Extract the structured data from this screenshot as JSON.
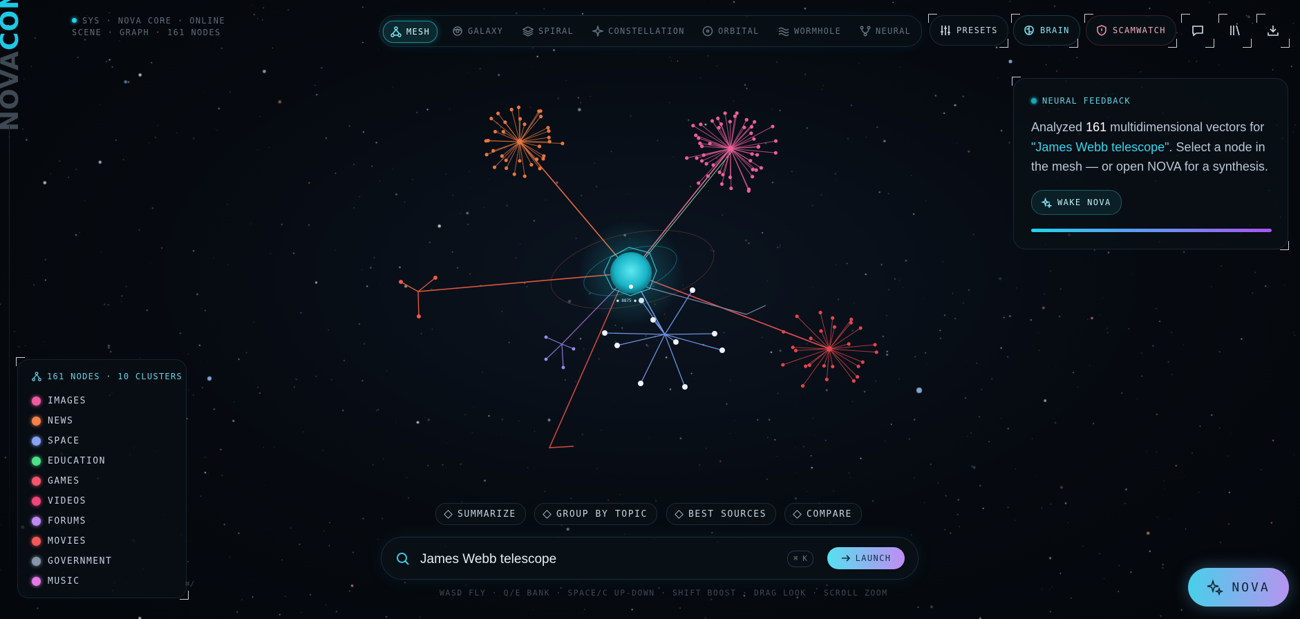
{
  "brand": {
    "part1": "NOVA",
    "part2": "CON"
  },
  "sysinfo": {
    "line1": "SYS · NOVA CORE · ONLINE",
    "line2": "SCENE · GRAPH · 161 NODES"
  },
  "modes": [
    {
      "label": "MESH",
      "icon": "mesh-icon",
      "active": true
    },
    {
      "label": "GALAXY",
      "icon": "galaxy-icon"
    },
    {
      "label": "SPIRAL",
      "icon": "layers-icon"
    },
    {
      "label": "CONSTELLATION",
      "icon": "sparkle-icon"
    },
    {
      "label": "ORBITAL",
      "icon": "orbit-icon"
    },
    {
      "label": "WORMHOLE",
      "icon": "waves-icon"
    },
    {
      "label": "NEURAL",
      "icon": "branch-icon"
    }
  ],
  "topbar": {
    "presets": "PRESETS",
    "brain": "BRAIN",
    "scamwatch": "SCAMWATCH",
    "chat_icon": "chat-icon",
    "library_icon": "library-icon",
    "download_icon": "download-icon"
  },
  "feedback": {
    "title": "NEURAL FEEDBACK",
    "text_before": "Analyzed ",
    "count": "161",
    "text_mid": " multidimensional vectors for ",
    "query": "\"James Webb telescope\"",
    "text_after": ". Select a node in the mesh — or open NOVA for a synthesis.",
    "wake_label": "WAKE NOVA",
    "progress": 1.0
  },
  "legend": {
    "header": "161 NODES · 10 CLUSTERS",
    "items": [
      {
        "label": "IMAGES",
        "color": "#f05aa0"
      },
      {
        "label": "NEWS",
        "color": "#f5824a"
      },
      {
        "label": "SPACE",
        "color": "#8aa2f5"
      },
      {
        "label": "EDUCATION",
        "color": "#4ee08a"
      },
      {
        "label": "GAMES",
        "color": "#f5566e"
      },
      {
        "label": "VIDEOS",
        "color": "#f0467a"
      },
      {
        "label": "FORUMS",
        "color": "#c08af5"
      },
      {
        "label": "MOVIES",
        "color": "#f25a5a"
      },
      {
        "label": "GOVERNMENT",
        "color": "#8696a8"
      },
      {
        "label": "MUSIC",
        "color": "#e27ae6"
      }
    ],
    "key_hint": "⌘/"
  },
  "quick_actions": [
    "SUMMARIZE",
    "GROUP BY TOPIC",
    "BEST SOURCES",
    "COMPARE"
  ],
  "search": {
    "value": "James Webb telescope",
    "shortcut": "⌘ K",
    "launch": "LAUNCH"
  },
  "hints": "WASD FLY · Q/E BANK · SPACE/C UP-DOWN · SHIFT BOOST · DRAG LOOK · SCROLL ZOOM",
  "nova_button": "NOVA",
  "core_label": "● 8875 ●"
}
